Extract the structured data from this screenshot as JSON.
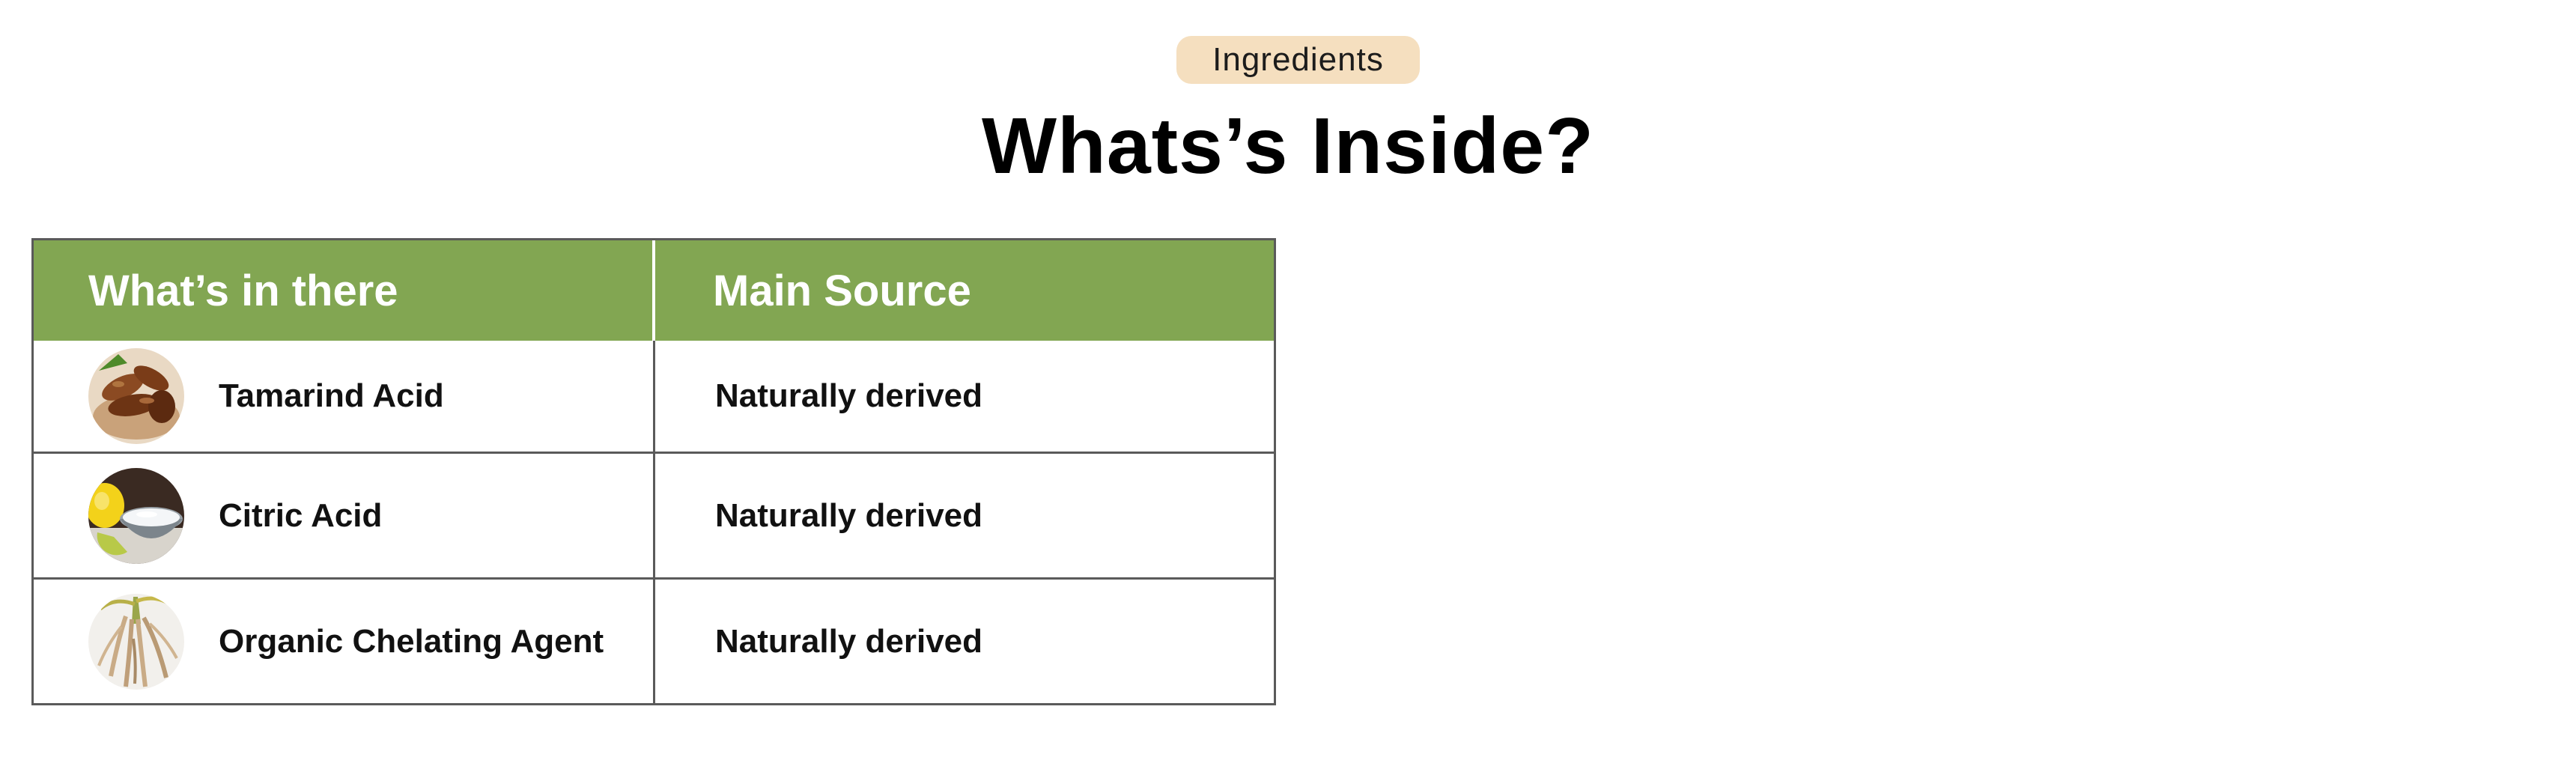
{
  "section_badge": "Ingredients",
  "heading": "Whats’s Inside?",
  "table": {
    "headers": [
      "What’s in there",
      "Main Source"
    ],
    "rows": [
      {
        "ingredient": "Tamarind Acid",
        "source": "Naturally derived",
        "image_icon": "tamarind-image"
      },
      {
        "ingredient": "Citric Acid",
        "source": "Naturally derived",
        "image_icon": "lemon-citric-image"
      },
      {
        "ingredient": "Organic Chelating Agent",
        "source": "Naturally derived",
        "image_icon": "root-image"
      }
    ]
  },
  "colors": {
    "header_bg": "#82a652",
    "badge_bg": "#f5dfbf",
    "border": "#5a5a5a"
  }
}
